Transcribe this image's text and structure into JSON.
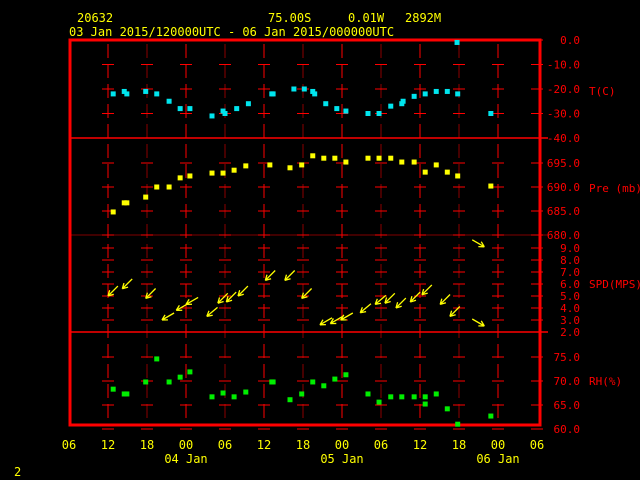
{
  "header": {
    "station": "20632",
    "lat": "75.00S",
    "lon": "0.01W",
    "elev": "2892M",
    "range": "03 Jan 2015/120000UTC - 06 Jan 2015/000000UTC"
  },
  "footer": {
    "page": "2"
  },
  "colors": {
    "frame": "#ff0000",
    "text": "#ffff00",
    "temp": "#00e5ee",
    "pres": "#ffff00",
    "wind": "#ffff00",
    "rh": "#00ee00"
  },
  "chart_data": [
    {
      "type": "scatter",
      "title": "Temperature",
      "ylabel": "T(C)",
      "ylim": [
        -40,
        0
      ],
      "yticks": [
        "0.0",
        "-10.0",
        "-20.0",
        "-30.0",
        "-40.0"
      ],
      "x_unit": "hours since 03 Jan 06UTC",
      "x": [
        6.8,
        8.5,
        8.9,
        11.8,
        13.5,
        15.4,
        17.1,
        18.6,
        22,
        23.7,
        24,
        25.8,
        27.6,
        31.2,
        31.4,
        34.6,
        36.2,
        37.5,
        37.8,
        39.5,
        41.2,
        42.6,
        46,
        47.7,
        49.5,
        51.2,
        51.4,
        53.1,
        54.8,
        56.5,
        58.2,
        59.8,
        59.7,
        64.9
      ],
      "y": [
        -22,
        -21,
        -22,
        -21,
        -22,
        -25,
        -28,
        -28,
        -31,
        -29,
        -30,
        -28,
        -26,
        -22,
        -22,
        -20,
        -20,
        -21,
        -22,
        -26,
        -28,
        -29,
        -30,
        -30,
        -27,
        -26,
        -25,
        -23,
        -22,
        -21,
        -21,
        -22,
        -1,
        -30
      ]
    },
    {
      "type": "scatter",
      "title": "Pressure",
      "ylabel": "Pre (mb)",
      "ylim": [
        680,
        698
      ],
      "yticks": [
        "695.0",
        "690.0",
        "685.0",
        "680.0"
      ],
      "x": [
        6.8,
        8.5,
        8.9,
        11.8,
        13.5,
        15.4,
        17.1,
        18.6,
        22,
        23.7,
        25.4,
        27.2,
        30.9,
        34,
        35.8,
        37.5,
        39.2,
        40.9,
        42.6,
        46,
        47.7,
        49.5,
        51.2,
        53.1,
        54.8,
        56.5,
        58.2,
        59.8,
        64.9
      ],
      "y": [
        684.8,
        686.7,
        686.7,
        687.9,
        690,
        690,
        691.9,
        692.3,
        692.9,
        692.9,
        693.5,
        694.4,
        694.6,
        694,
        694.6,
        696.5,
        696,
        696,
        695.2,
        696,
        696,
        696,
        695.2,
        695.2,
        693.1,
        694.6,
        693.1,
        692.3,
        690.2
      ]
    },
    {
      "type": "scatter",
      "title": "Wind",
      "ylabel": "SPD(MPS)",
      "ylim": [
        2,
        10
      ],
      "yticks": [
        "9.0",
        "8.0",
        "7.0",
        "6.0",
        "5.0",
        "4.0",
        "3.0",
        "2.0"
      ],
      "x": [
        6,
        8.2,
        11.8,
        14.3,
        16.5,
        18,
        21.2,
        22.9,
        24.2,
        26,
        30.2,
        33.2,
        35.8,
        38.6,
        40.2,
        41.8,
        44.8,
        47.1,
        48.6,
        50.3,
        52.5,
        54.3,
        57.1,
        58.6,
        63.9,
        63.9
      ],
      "y": [
        5.0,
        5.6,
        4.8,
        3.0,
        3.8,
        4.3,
        3.3,
        4.4,
        4.5,
        5.0,
        6.3,
        6.3,
        4.8,
        2.6,
        2.7,
        3.0,
        3.6,
        4.3,
        4.4,
        4.0,
        4.5,
        5.1,
        4.3,
        3.3,
        9.1,
        2.5
      ],
      "dir_deg": [
        45,
        45,
        45,
        60,
        60,
        60,
        50,
        45,
        45,
        45,
        45,
        45,
        45,
        60,
        60,
        60,
        50,
        50,
        45,
        45,
        45,
        45,
        45,
        45,
        300,
        300
      ]
    },
    {
      "type": "scatter",
      "title": "Relative humidity",
      "ylabel": "RH(%)",
      "ylim": [
        60,
        77
      ],
      "yticks": [
        "75.0",
        "70.0",
        "65.0",
        "60.0"
      ],
      "x": [
        6.8,
        8.5,
        8.9,
        11.8,
        13.5,
        15.4,
        17.1,
        18.6,
        22,
        23.7,
        25.4,
        27.2,
        31.2,
        31.4,
        34,
        35.8,
        37.5,
        39.2,
        40.9,
        42.6,
        46,
        47.7,
        49.5,
        51.2,
        53.1,
        54.8,
        54.8,
        56.5,
        58.2,
        59.8,
        64.9
      ],
      "y": [
        68.3,
        67.3,
        67.3,
        69.8,
        74.6,
        69.8,
        70.8,
        71.9,
        66.7,
        67.5,
        66.7,
        67.7,
        69.8,
        69.8,
        66.1,
        67.3,
        69.8,
        69,
        70.4,
        71.3,
        67.3,
        65.6,
        66.7,
        66.7,
        66.7,
        66.7,
        65.2,
        67.3,
        64.2,
        61,
        62.7
      ]
    }
  ],
  "xaxis": {
    "ticks": [
      "06",
      "12",
      "18",
      "00",
      "06",
      "12",
      "18",
      "00",
      "06",
      "12",
      "18",
      "00",
      "06"
    ],
    "days": [
      "04 Jan",
      "05 Jan",
      "06 Jan"
    ]
  }
}
